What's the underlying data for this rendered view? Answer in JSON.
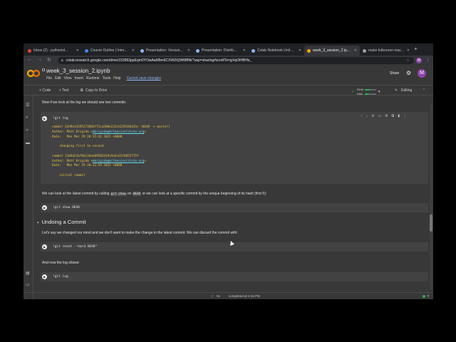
{
  "browser": {
    "tabs": [
      {
        "label": "Inbox (2) - pythonist...",
        "color": "#ea4335"
      },
      {
        "label": "Course Outline | Intro...",
        "color": "#4285f4"
      },
      {
        "label": "Presentation: Version...",
        "color": "#8ab4f8"
      },
      {
        "label": "Presentation: Distrib...",
        "color": "#8ab4f8"
      },
      {
        "label": "Colab Notebook Unit ...",
        "color": "#8ab4f8"
      },
      {
        "label": "week_3_session_2.ip...",
        "color": "#f9ab00"
      },
      {
        "label": "make fullscreen mac...",
        "color": "#9aa0a6"
      }
    ],
    "url": "colab.research.google.com/drive/153963ppEqm0YOwAaM5m6CXWZtQW6fBNr?usp=sharing#scrollTo=jyIrqOtHBHs_",
    "profile_initial": "M"
  },
  "colab": {
    "notebook_name": "week_3_session_2.ipynb",
    "menus": [
      "File",
      "Edit",
      "View",
      "Insert",
      "Runtime",
      "Tools",
      "Help"
    ],
    "unsaved": "Cannot save changes",
    "share": "Share",
    "avatar": "M",
    "toolbar": {
      "code": "+ Code",
      "text": "+ Text",
      "copy": "Copy to Drive",
      "ram": "RAM",
      "disk": "Disk",
      "ram_level": 0.45,
      "disk_level": 0.3,
      "editing": "Editing"
    }
  },
  "notebook": {
    "text1": "Now if we look at the log we should see two commits:",
    "cell1_code": "!git log",
    "log": {
      "c1_hash": "commit 63d9e13595273803f71ca508e232cb23934bd15c ",
      "c1_ref": "(HEAD -> master)",
      "c1_author_label": "Author: Matt Brigida <",
      "c1_email": "mbrigida@milkeninstitute.org",
      "c1_author_end": ">",
      "c1_date": "Date:   Mon Mar 29 20:15:41 2021 +0000",
      "c1_msg": "    changing first to second",
      "c2_hash": "commit 1166d21bf0dc34ee89502d19c9a4c65f6052775f",
      "c2_author_label": "Author: Matt Brigida <",
      "c2_email": "mbrigida@milkeninstitute.org",
      "c2_author_end": ">",
      "c2_date": "Date:   Mon Mar 29 20:12:59 2021 +0000",
      "c2_msg": "    initial commit"
    },
    "text2a": "We can look at the latest commit by calling ",
    "text2_code1": "git show",
    "text2b": " on ",
    "text2_code2": "HEAD",
    "text2c": " or we can look at a specific commit by the unique beginning of its hash (first 5):",
    "cell2_code": "!git show HEAD",
    "section": "Undoing a Commit",
    "text3": "Let's say we changed our mind and we don't want to make the change in the latest commit. We can discard the commit with:",
    "cell3_code": "!git reset --hard HEAD^",
    "text4": "And now the log shows:",
    "cell4_code": "!git log"
  },
  "status": {
    "check": "✓",
    "seconds": "0s",
    "completed": "completed at 4:15 PM"
  }
}
